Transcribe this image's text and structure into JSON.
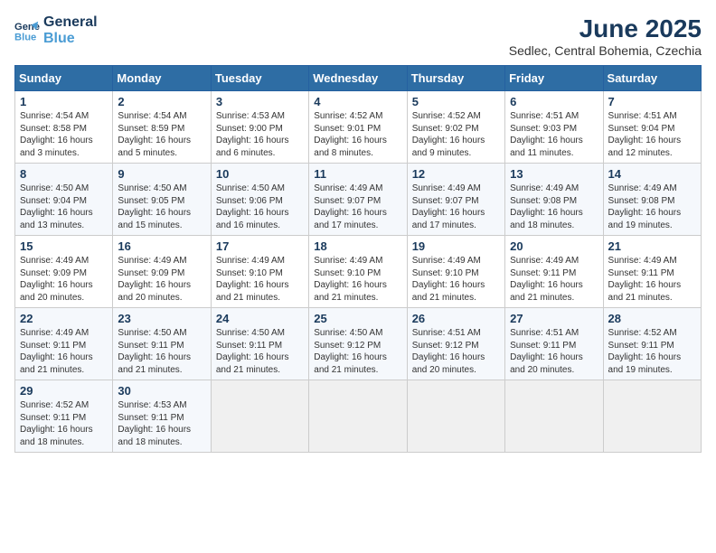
{
  "logo": {
    "line1": "General",
    "line2": "Blue"
  },
  "title": "June 2025",
  "subtitle": "Sedlec, Central Bohemia, Czechia",
  "weekdays": [
    "Sunday",
    "Monday",
    "Tuesday",
    "Wednesday",
    "Thursday",
    "Friday",
    "Saturday"
  ],
  "weeks": [
    [
      {
        "day": 1,
        "info": "Sunrise: 4:54 AM\nSunset: 8:58 PM\nDaylight: 16 hours\nand 3 minutes."
      },
      {
        "day": 2,
        "info": "Sunrise: 4:54 AM\nSunset: 8:59 PM\nDaylight: 16 hours\nand 5 minutes."
      },
      {
        "day": 3,
        "info": "Sunrise: 4:53 AM\nSunset: 9:00 PM\nDaylight: 16 hours\nand 6 minutes."
      },
      {
        "day": 4,
        "info": "Sunrise: 4:52 AM\nSunset: 9:01 PM\nDaylight: 16 hours\nand 8 minutes."
      },
      {
        "day": 5,
        "info": "Sunrise: 4:52 AM\nSunset: 9:02 PM\nDaylight: 16 hours\nand 9 minutes."
      },
      {
        "day": 6,
        "info": "Sunrise: 4:51 AM\nSunset: 9:03 PM\nDaylight: 16 hours\nand 11 minutes."
      },
      {
        "day": 7,
        "info": "Sunrise: 4:51 AM\nSunset: 9:04 PM\nDaylight: 16 hours\nand 12 minutes."
      }
    ],
    [
      {
        "day": 8,
        "info": "Sunrise: 4:50 AM\nSunset: 9:04 PM\nDaylight: 16 hours\nand 13 minutes."
      },
      {
        "day": 9,
        "info": "Sunrise: 4:50 AM\nSunset: 9:05 PM\nDaylight: 16 hours\nand 15 minutes."
      },
      {
        "day": 10,
        "info": "Sunrise: 4:50 AM\nSunset: 9:06 PM\nDaylight: 16 hours\nand 16 minutes."
      },
      {
        "day": 11,
        "info": "Sunrise: 4:49 AM\nSunset: 9:07 PM\nDaylight: 16 hours\nand 17 minutes."
      },
      {
        "day": 12,
        "info": "Sunrise: 4:49 AM\nSunset: 9:07 PM\nDaylight: 16 hours\nand 17 minutes."
      },
      {
        "day": 13,
        "info": "Sunrise: 4:49 AM\nSunset: 9:08 PM\nDaylight: 16 hours\nand 18 minutes."
      },
      {
        "day": 14,
        "info": "Sunrise: 4:49 AM\nSunset: 9:08 PM\nDaylight: 16 hours\nand 19 minutes."
      }
    ],
    [
      {
        "day": 15,
        "info": "Sunrise: 4:49 AM\nSunset: 9:09 PM\nDaylight: 16 hours\nand 20 minutes."
      },
      {
        "day": 16,
        "info": "Sunrise: 4:49 AM\nSunset: 9:09 PM\nDaylight: 16 hours\nand 20 minutes."
      },
      {
        "day": 17,
        "info": "Sunrise: 4:49 AM\nSunset: 9:10 PM\nDaylight: 16 hours\nand 21 minutes."
      },
      {
        "day": 18,
        "info": "Sunrise: 4:49 AM\nSunset: 9:10 PM\nDaylight: 16 hours\nand 21 minutes."
      },
      {
        "day": 19,
        "info": "Sunrise: 4:49 AM\nSunset: 9:10 PM\nDaylight: 16 hours\nand 21 minutes."
      },
      {
        "day": 20,
        "info": "Sunrise: 4:49 AM\nSunset: 9:11 PM\nDaylight: 16 hours\nand 21 minutes."
      },
      {
        "day": 21,
        "info": "Sunrise: 4:49 AM\nSunset: 9:11 PM\nDaylight: 16 hours\nand 21 minutes."
      }
    ],
    [
      {
        "day": 22,
        "info": "Sunrise: 4:49 AM\nSunset: 9:11 PM\nDaylight: 16 hours\nand 21 minutes."
      },
      {
        "day": 23,
        "info": "Sunrise: 4:50 AM\nSunset: 9:11 PM\nDaylight: 16 hours\nand 21 minutes."
      },
      {
        "day": 24,
        "info": "Sunrise: 4:50 AM\nSunset: 9:11 PM\nDaylight: 16 hours\nand 21 minutes."
      },
      {
        "day": 25,
        "info": "Sunrise: 4:50 AM\nSunset: 9:12 PM\nDaylight: 16 hours\nand 21 minutes."
      },
      {
        "day": 26,
        "info": "Sunrise: 4:51 AM\nSunset: 9:12 PM\nDaylight: 16 hours\nand 20 minutes."
      },
      {
        "day": 27,
        "info": "Sunrise: 4:51 AM\nSunset: 9:11 PM\nDaylight: 16 hours\nand 20 minutes."
      },
      {
        "day": 28,
        "info": "Sunrise: 4:52 AM\nSunset: 9:11 PM\nDaylight: 16 hours\nand 19 minutes."
      }
    ],
    [
      {
        "day": 29,
        "info": "Sunrise: 4:52 AM\nSunset: 9:11 PM\nDaylight: 16 hours\nand 18 minutes."
      },
      {
        "day": 30,
        "info": "Sunrise: 4:53 AM\nSunset: 9:11 PM\nDaylight: 16 hours\nand 18 minutes."
      },
      null,
      null,
      null,
      null,
      null
    ]
  ]
}
